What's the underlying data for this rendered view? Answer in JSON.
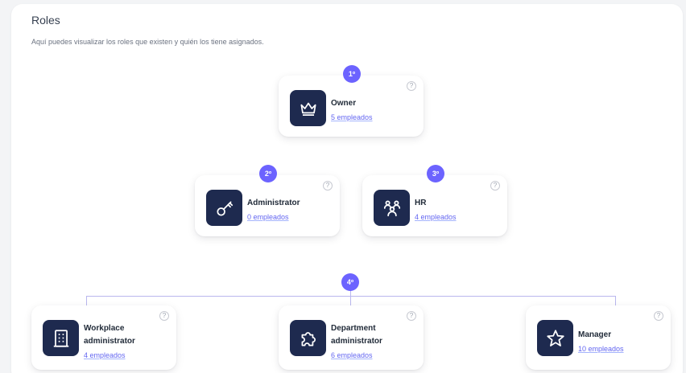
{
  "header": {
    "title": "Roles",
    "subtitle": "Aquí puedes visualizar los roles que existen y quién los tiene asignados."
  },
  "help_symbol": "?",
  "colors": {
    "accent": "#6c63ff",
    "icon_bg": "#1e2a4f",
    "link": "#6366f1",
    "connector": "#b9b7ee"
  },
  "roles": [
    {
      "rank": "1º",
      "name": "Owner",
      "count": "5 empleados",
      "icon": "crown-icon"
    },
    {
      "rank": "2º",
      "name": "Administrator",
      "count": "0 empleados",
      "icon": "key-icon"
    },
    {
      "rank": "3º",
      "name": "HR",
      "count": "4 empleados",
      "icon": "people-icon"
    },
    {
      "rank": "4º",
      "name": "Workplace administrator",
      "count": "4 empleados",
      "icon": "building-icon"
    },
    {
      "rank": "4º",
      "name": "Department administrator",
      "count": "6 empleados",
      "icon": "puzzle-icon"
    },
    {
      "rank": "4º",
      "name": "Manager",
      "count": "10 empleados",
      "icon": "star-icon"
    }
  ]
}
